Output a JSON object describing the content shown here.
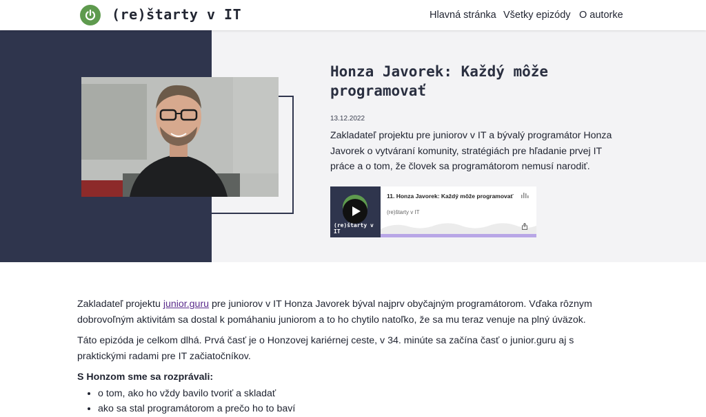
{
  "header": {
    "site_title": "(re)štarty v IT",
    "nav": [
      "Hlavná stránka",
      "Všetky epizódy",
      "O autorke"
    ]
  },
  "episode": {
    "title": "Honza Javorek: Každý môže programovať",
    "date": "13.12.2022",
    "description": "Zakladateľ projektu pre juniorov v IT a bývalý programátor Honza Javorek o vytváraní komunity, stratégiách pre hľadanie prvej IT práce a o tom, že človek sa programátorom nemusí narodiť."
  },
  "player": {
    "episode_title": "11. Honza Javorek: Každý môže programovať",
    "show_name": "(re)štarty v IT",
    "art_label": "(re)štarty v IT",
    "progress": 1.0
  },
  "content": {
    "p1_before": "Zakladateľ projektu ",
    "p1_link": "junior.guru",
    "p1_after": " pre juniorov v IT Honza Javorek býval najprv obyčajným programátorom. Vďaka rôznym dobrovoľným aktivitám sa dostal k pomáhaniu juniorom a to ho chytilo natoľko, že sa mu teraz venuje na plný úväzok.",
    "p2": "Táto epizóda je celkom dlhá. Prvá časť je o Honzovej kariérnej ceste, v 34. minúte sa začína časť o junior.guru aj s praktickými radami pre IT začiatočníkov.",
    "subhead": "S Honzom sme sa rozprávali:",
    "bullets": [
      "o tom, ako ho vždy bavilo tvoriť a skladať",
      "ako sa stal programátorom a prečo ho to baví"
    ]
  },
  "colors": {
    "brand_green": "#5e9a4e",
    "dark_navy": "#2f354d",
    "link": "#5a2b8c",
    "player_bar": "#b8a6e6"
  },
  "icons": [
    "power-icon",
    "play-icon",
    "soundwave-icon",
    "share-icon"
  ]
}
